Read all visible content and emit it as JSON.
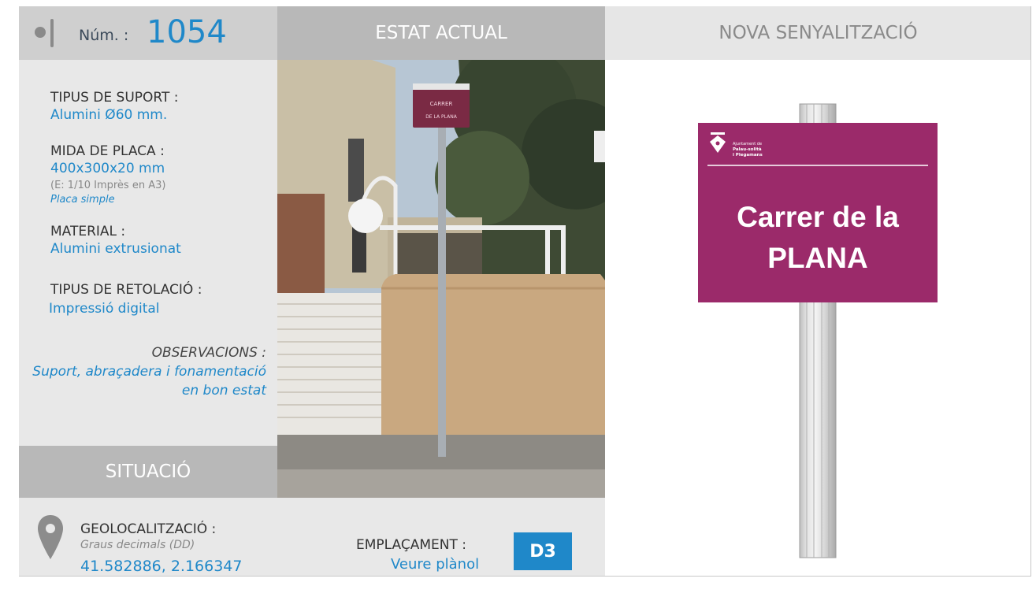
{
  "header": {
    "num_label": "Núm. :",
    "num_value": "1054",
    "estat_actual": "ESTAT ACTUAL",
    "nova_senyalitzacio": "NOVA SENYALITZACIÓ"
  },
  "specs": {
    "suport_title": "TIPUS DE SUPORT :",
    "suport_value": "Alumini Ø60 mm.",
    "placa_title": "MIDA DE PLACA :",
    "placa_value": "400x300x20 mm",
    "placa_note": "(E: 1/10 Imprès en A3)",
    "placa_type": "Placa simple",
    "material_title": "MATERIAL :",
    "material_value": "Alumini extrusionat",
    "retolacio_title": "TIPUS DE RETOLACIÓ :",
    "retolacio_value": "Impressió digital",
    "observacions_title": "OBSERVACIONS :",
    "observacions_value": "Suport, abraçadera i fonamentació en bon estat"
  },
  "situacio": {
    "label": "SITUACIÓ",
    "geo_title": "GEOLOCALITZACIÓ :",
    "geo_sub": "Graus decimals (DD)",
    "geo_value": "41.582886, 2.166347",
    "empl_title": "EMPLAÇAMENT :",
    "empl_value": "Veure plànol",
    "empl_code": "D3"
  },
  "photo": {
    "sign_line1": "CARRER",
    "sign_line2": "DE LA PLANA"
  },
  "sign": {
    "logo_line1": "Ajuntament de",
    "logo_line2": "Palau-solità",
    "logo_line3": "i Plegamans",
    "title_line1": "Carrer de la",
    "title_line2": "PLANA"
  },
  "colors": {
    "accent": "#1f88c9",
    "sign_purple": "#9b2a6a",
    "header_grey": "#b8b8b8",
    "panel_grey": "#e8e8e8"
  }
}
